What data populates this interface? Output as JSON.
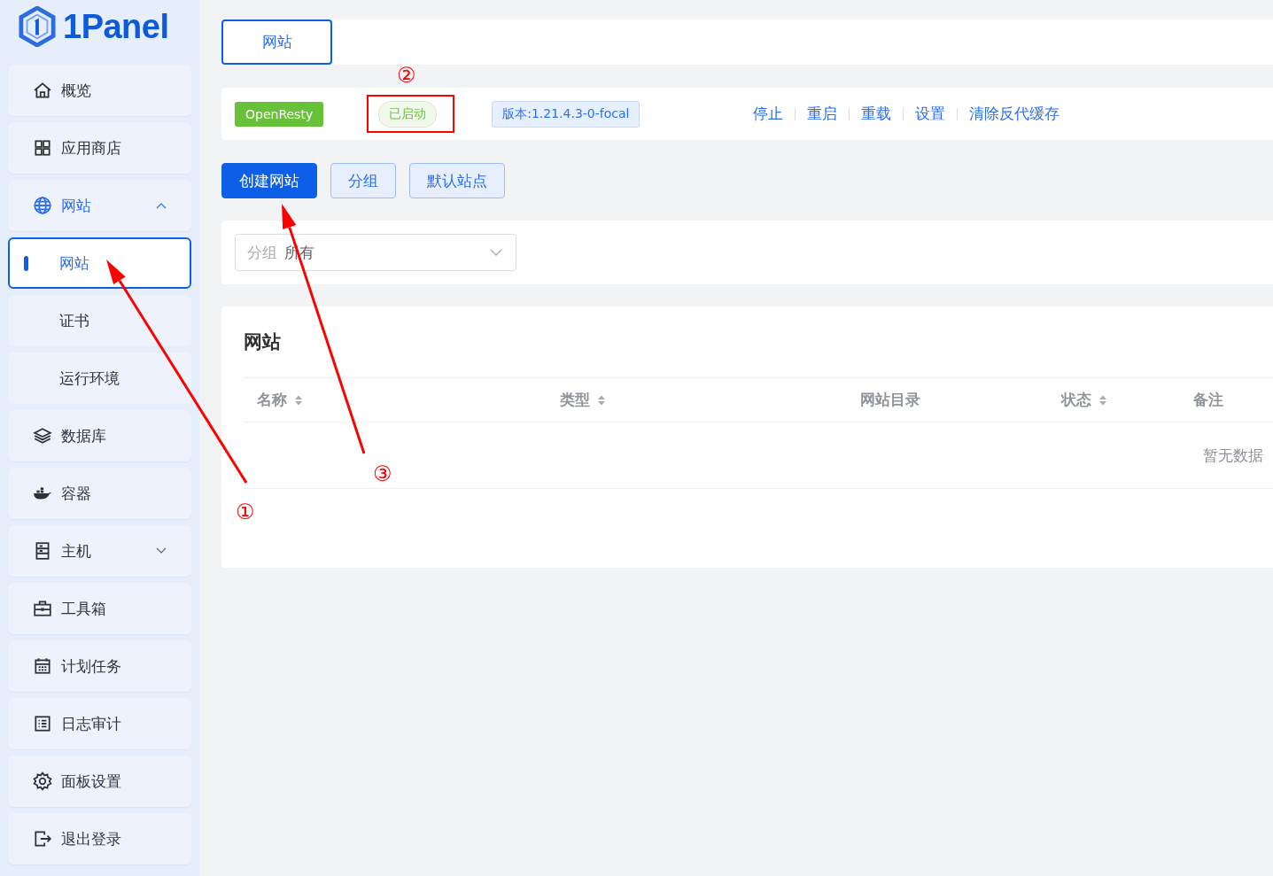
{
  "logo": {
    "text": "1Panel"
  },
  "sidebar": {
    "items": [
      {
        "label": "概览",
        "selected": false
      },
      {
        "label": "应用商店",
        "selected": false
      },
      {
        "label": "网站",
        "selected": true,
        "expanded": true,
        "children": [
          {
            "label": "网站",
            "selected": true
          },
          {
            "label": "证书",
            "selected": false
          },
          {
            "label": "运行环境",
            "selected": false
          }
        ]
      },
      {
        "label": "数据库",
        "selected": false
      },
      {
        "label": "容器",
        "selected": false
      },
      {
        "label": "主机",
        "selected": false,
        "expanded": false
      },
      {
        "label": "工具箱",
        "selected": false
      },
      {
        "label": "计划任务",
        "selected": false
      },
      {
        "label": "日志审计",
        "selected": false
      },
      {
        "label": "面板设置",
        "selected": false
      },
      {
        "label": "退出登录",
        "selected": false
      }
    ]
  },
  "tabs": [
    {
      "label": "网站",
      "selected": true
    }
  ],
  "server_status": {
    "app": "OpenResty",
    "status": "已启动",
    "version": "版本:1.21.4.3-0-focal",
    "actions": [
      "停止",
      "重启",
      "重载",
      "设置",
      "清除反代缓存"
    ]
  },
  "toolbar": {
    "buttons": [
      {
        "label": "创建网站",
        "kind": "primary"
      },
      {
        "label": "分组",
        "kind": "plain"
      },
      {
        "label": "默认站点",
        "kind": "plain"
      }
    ]
  },
  "filter": {
    "label": "分组",
    "value": "所有"
  },
  "table": {
    "title": "网站",
    "columns": [
      {
        "label": "名称",
        "sortable": true
      },
      {
        "label": "类型",
        "sortable": true
      },
      {
        "label": "网站目录",
        "sortable": false
      },
      {
        "label": "状态",
        "sortable": true
      },
      {
        "label": "备注",
        "sortable": false
      }
    ],
    "empty_text": "暂无数据"
  },
  "annotations": [
    "①",
    "②",
    "③"
  ]
}
